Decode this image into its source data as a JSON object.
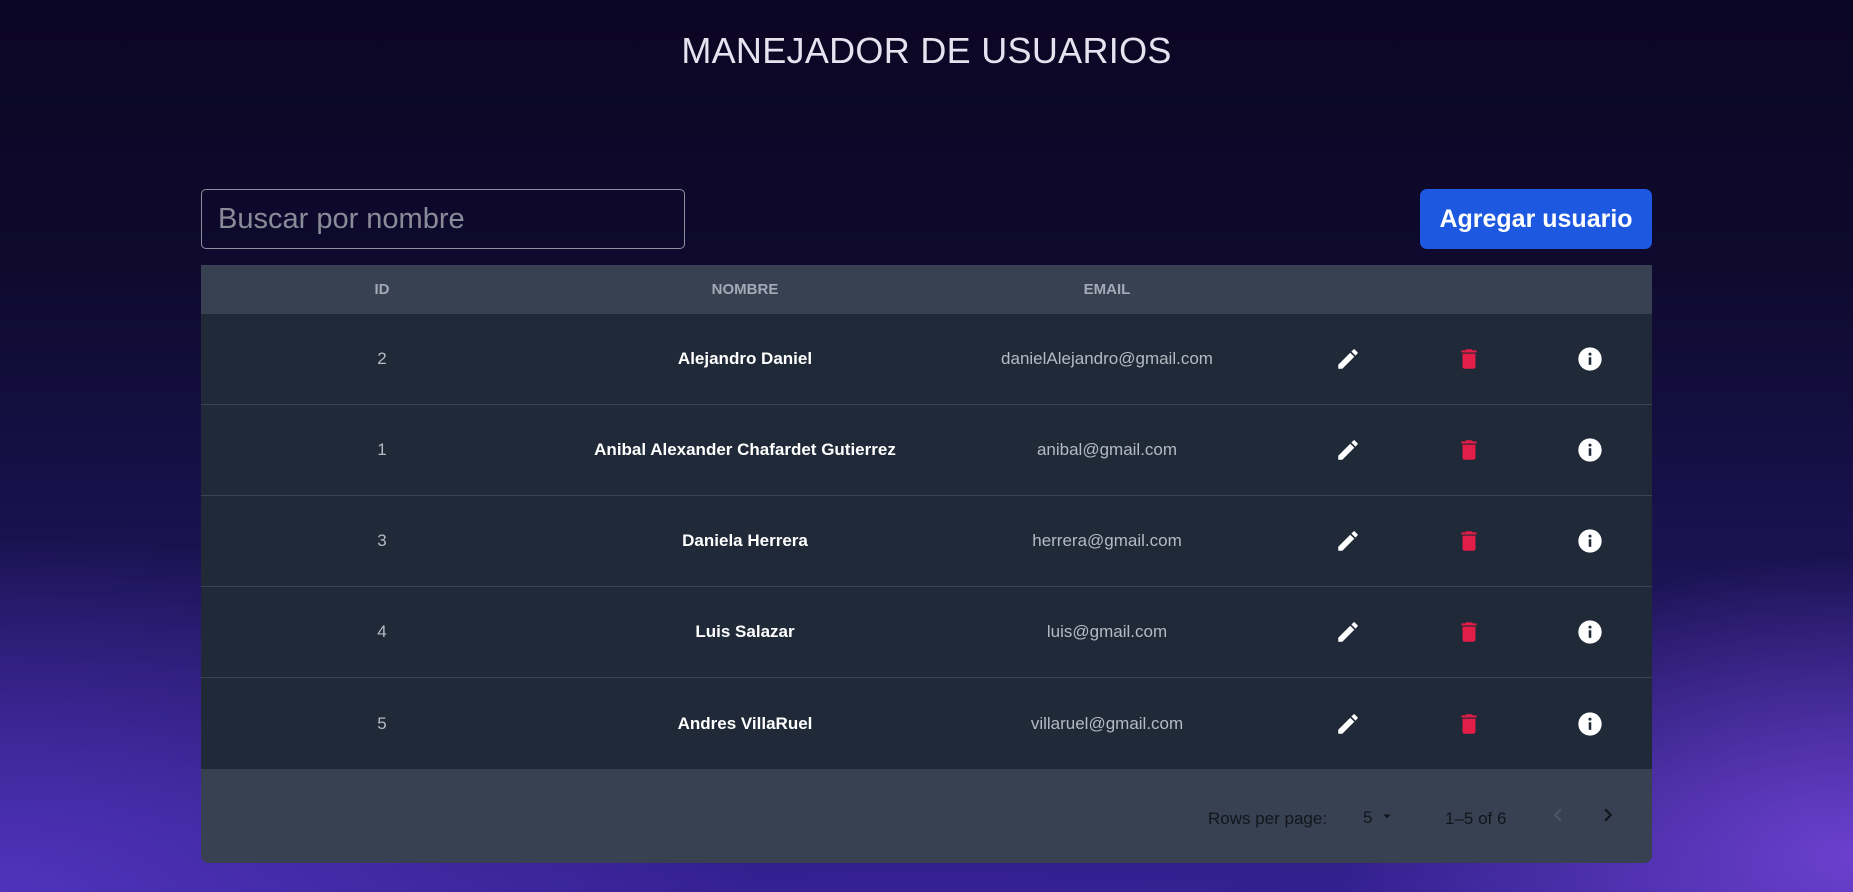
{
  "header": {
    "title": "MANEJADOR DE USUARIOS"
  },
  "search": {
    "placeholder": "Buscar por nombre",
    "value": ""
  },
  "toolbar": {
    "add_label": "Agregar usuario"
  },
  "table": {
    "columns": [
      "ID",
      "NOMBRE",
      "EMAIL"
    ],
    "rows": [
      {
        "id": "2",
        "nombre": "Alejandro Daniel",
        "email": "danielAlejandro@gmail.com"
      },
      {
        "id": "1",
        "nombre": "Anibal Alexander Chafardet Gutierrez",
        "email": "anibal@gmail.com"
      },
      {
        "id": "3",
        "nombre": "Daniela Herrera",
        "email": "herrera@gmail.com"
      },
      {
        "id": "4",
        "nombre": "Luis Salazar",
        "email": "luis@gmail.com"
      },
      {
        "id": "5",
        "nombre": "Andres VillaRuel",
        "email": "villaruel@gmail.com"
      }
    ],
    "row_actions": [
      "edit-icon",
      "delete-icon",
      "info-icon"
    ]
  },
  "pagination": {
    "rows_per_page_label": "Rows per page:",
    "rows_per_page_value": "5",
    "range_text": "1–5 of 6"
  },
  "colors": {
    "accent": "#1c58e0",
    "delete": "#e11d48",
    "header_bg": "#374151",
    "row_bg": "#1f2937"
  }
}
